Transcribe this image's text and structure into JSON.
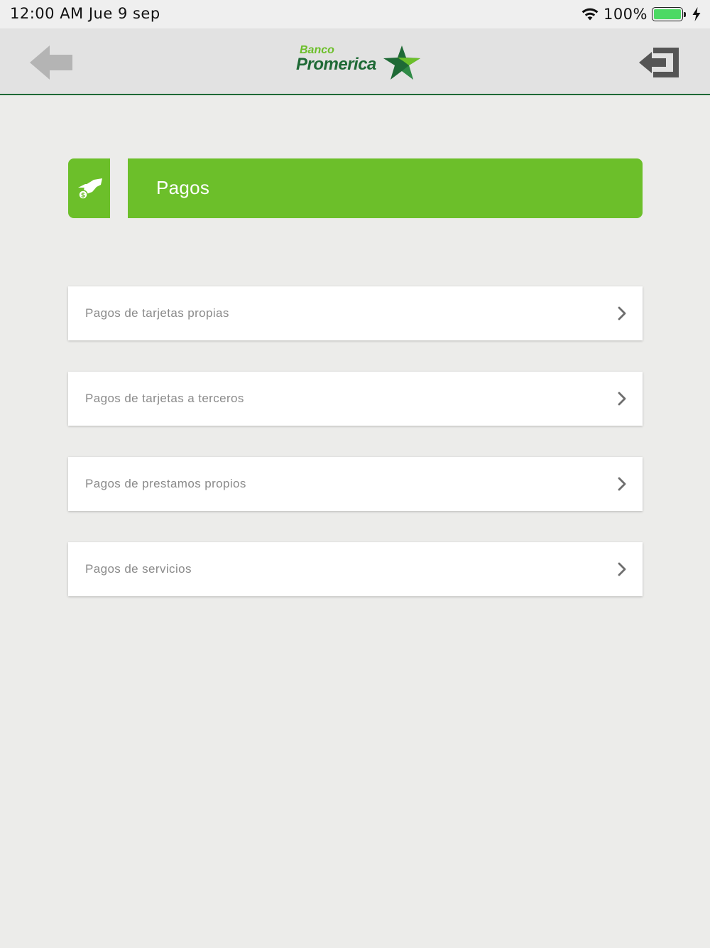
{
  "status_bar": {
    "time": "12:00 AM  Jue 9 sep",
    "battery_percent": "100%",
    "battery_level": 1.0,
    "wifi_icon": "wifi-icon",
    "charging_icon": "charging-bolt-icon"
  },
  "header": {
    "back_icon": "arrow-left-icon",
    "logout_icon": "logout-icon",
    "logo": {
      "line1": "Banco",
      "line2": "Promerica",
      "star_icon": "promerica-star-icon"
    }
  },
  "section": {
    "title": "Pagos",
    "icon": "payment-hand-icon"
  },
  "menu": {
    "items": [
      {
        "label": "Pagos de tarjetas propias"
      },
      {
        "label": "Pagos de tarjetas a terceros"
      },
      {
        "label": "Pagos de prestamos propios"
      },
      {
        "label": "Pagos de servicios"
      }
    ],
    "chevron_icon": "chevron-right-icon"
  },
  "colors": {
    "brand_green": "#6cbf2a",
    "brand_dark_green": "#1f6a36",
    "background": "#ececea",
    "header_bg": "#e2e2e2",
    "label_gray": "#8a8a8a"
  }
}
